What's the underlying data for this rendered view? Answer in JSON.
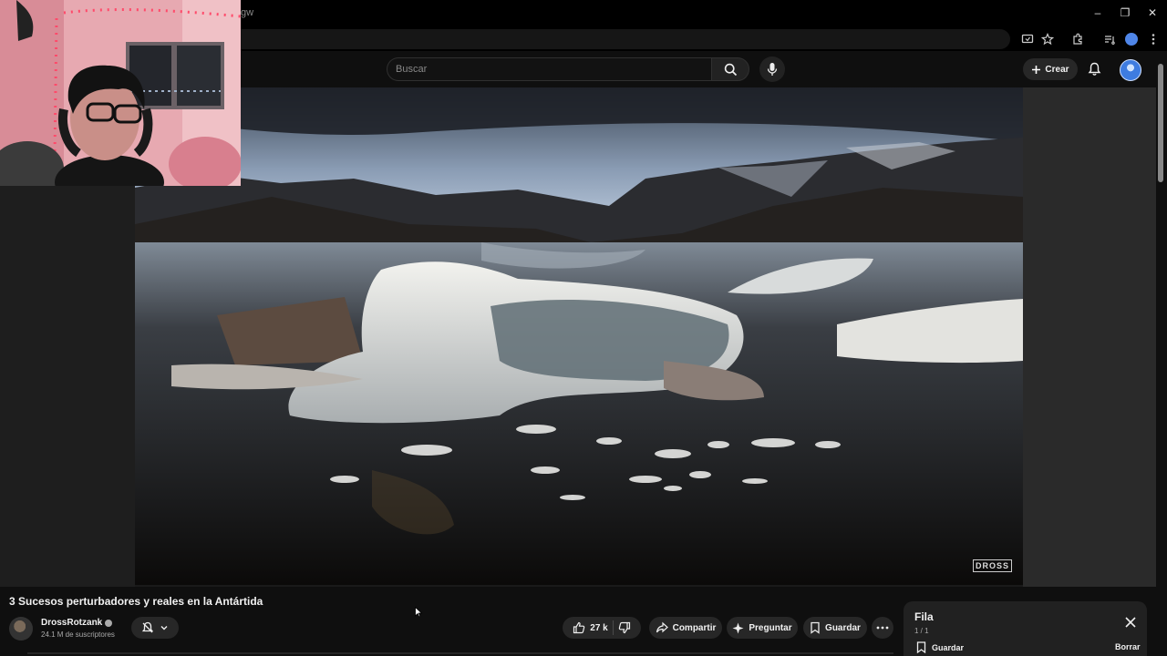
{
  "browser": {
    "url_fragment": "gw",
    "window_controls": [
      "–",
      "❐",
      "✕"
    ]
  },
  "header": {
    "search_placeholder": "Buscar",
    "create_label": "Crear"
  },
  "video": {
    "title": "3 Sucesos perturbadores y reales en la Antártida",
    "watermark": "DROSS"
  },
  "channel": {
    "name": "DrossRotzank",
    "subscribers": "24.1 M de suscriptores"
  },
  "actions": {
    "likes": "27 k",
    "share": "Compartir",
    "ask": "Preguntar",
    "save": "Guardar"
  },
  "queue": {
    "title": "Fila",
    "count": "1 / 1",
    "save": "Guardar",
    "clear": "Borrar"
  }
}
